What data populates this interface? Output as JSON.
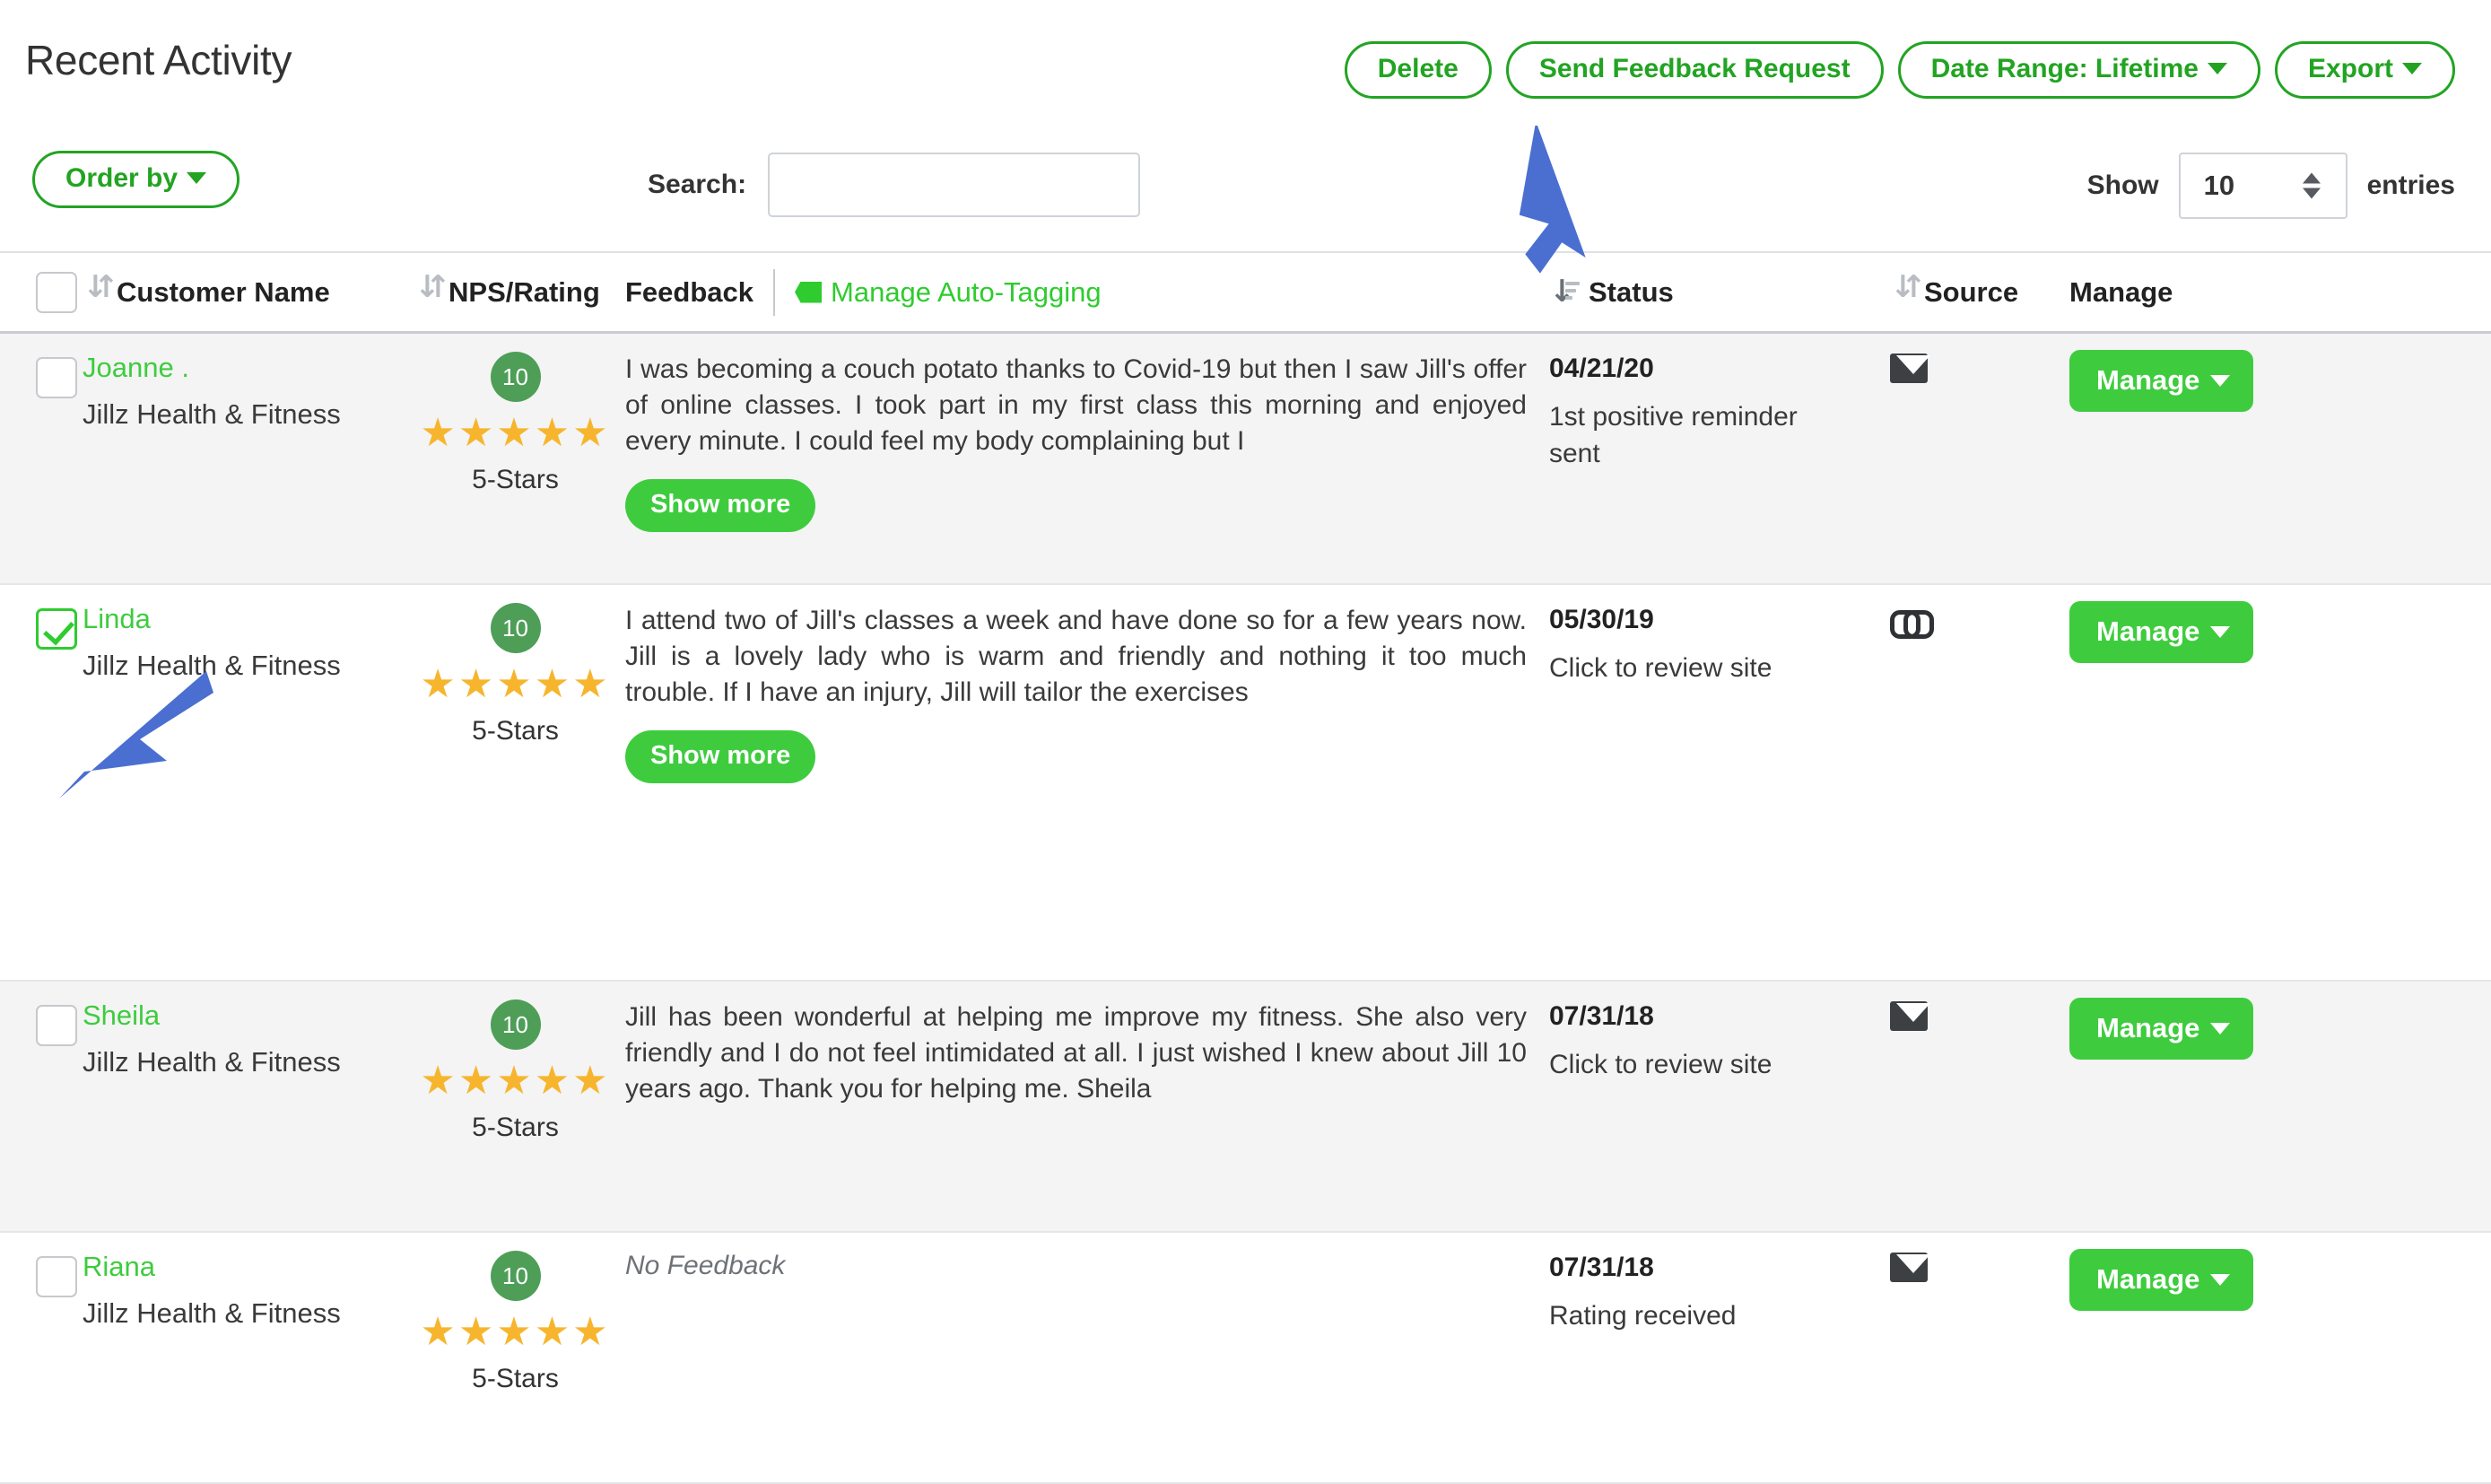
{
  "header": {
    "title": "Recent Activity",
    "buttons": [
      {
        "label": "Delete",
        "caret": false
      },
      {
        "label": "Send Feedback Request",
        "caret": false
      },
      {
        "label": "Date Range: Lifetime",
        "caret": true
      },
      {
        "label": "Export",
        "caret": true
      }
    ]
  },
  "controls": {
    "order_by_label": "Order by",
    "search_label": "Search:",
    "search_value": "",
    "search_placeholder": "",
    "show_label": "Show",
    "entries_label": "entries",
    "entries_value": "10"
  },
  "table": {
    "headers": {
      "customer_name": "Customer Name",
      "nps_rating": "NPS/Rating",
      "feedback": "Feedback",
      "auto_tagging": "Manage Auto-Tagging",
      "status": "Status",
      "source": "Source",
      "manage": "Manage"
    },
    "manage_button_label": "Manage",
    "show_more_label": "Show more",
    "rows": [
      {
        "checked": false,
        "name": "Joanne .",
        "business": "Jillz Health & Fitness",
        "nps": "10",
        "stars": 5,
        "star_label": "5-Stars",
        "feedback": "I was becoming a couch potato thanks to Covid-19 but then I saw Jill's offer of online classes. I took part in my first class this morning and enjoyed every minute. I could feel my body complaining but I",
        "has_show_more": true,
        "date": "04/21/20",
        "status": "1st positive reminder sent",
        "source_icon": "mail-icon"
      },
      {
        "checked": true,
        "name": "Linda",
        "business": "Jillz Health & Fitness",
        "nps": "10",
        "stars": 5,
        "star_label": "5-Stars",
        "feedback": "I attend two of Jill's classes a week and have done so for a few years now. Jill is a lovely lady who is warm and friendly and nothing it too much trouble. If I have an injury, Jill will tailor the exercises",
        "has_show_more": true,
        "date": "05/30/19",
        "status": "Click to review site",
        "source_icon": "link-icon"
      },
      {
        "checked": false,
        "name": "Sheila ",
        "business": "Jillz Health & Fitness",
        "nps": "10",
        "stars": 5,
        "star_label": "5-Stars",
        "feedback": "Jill has been wonderful at helping me improve my fitness. She also very friendly and I do not feel intimidated at all. I just wished I knew about Jill 10 years ago. Thank you for helping me. Sheila",
        "has_show_more": false,
        "date": "07/31/18",
        "status": "Click to review site",
        "source_icon": "mail-icon"
      },
      {
        "checked": false,
        "name": "Riana",
        "business": "Jillz Health & Fitness",
        "nps": "10",
        "stars": 5,
        "star_label": "5-Stars",
        "feedback": "No Feedback",
        "no_feedback": true,
        "has_show_more": false,
        "date": "07/31/18",
        "status": "Rating received",
        "source_icon": "mail-icon"
      }
    ]
  },
  "colors": {
    "brand_green": "#22a422",
    "bright_green": "#3ecc3e",
    "nps_green": "#4e9e58",
    "star_gold": "#f7b52e",
    "annotation_blue": "#4a6fd0"
  },
  "annotations": [
    {
      "name": "arrow-to-delete-button"
    },
    {
      "name": "arrow-to-linda-checkbox"
    }
  ]
}
